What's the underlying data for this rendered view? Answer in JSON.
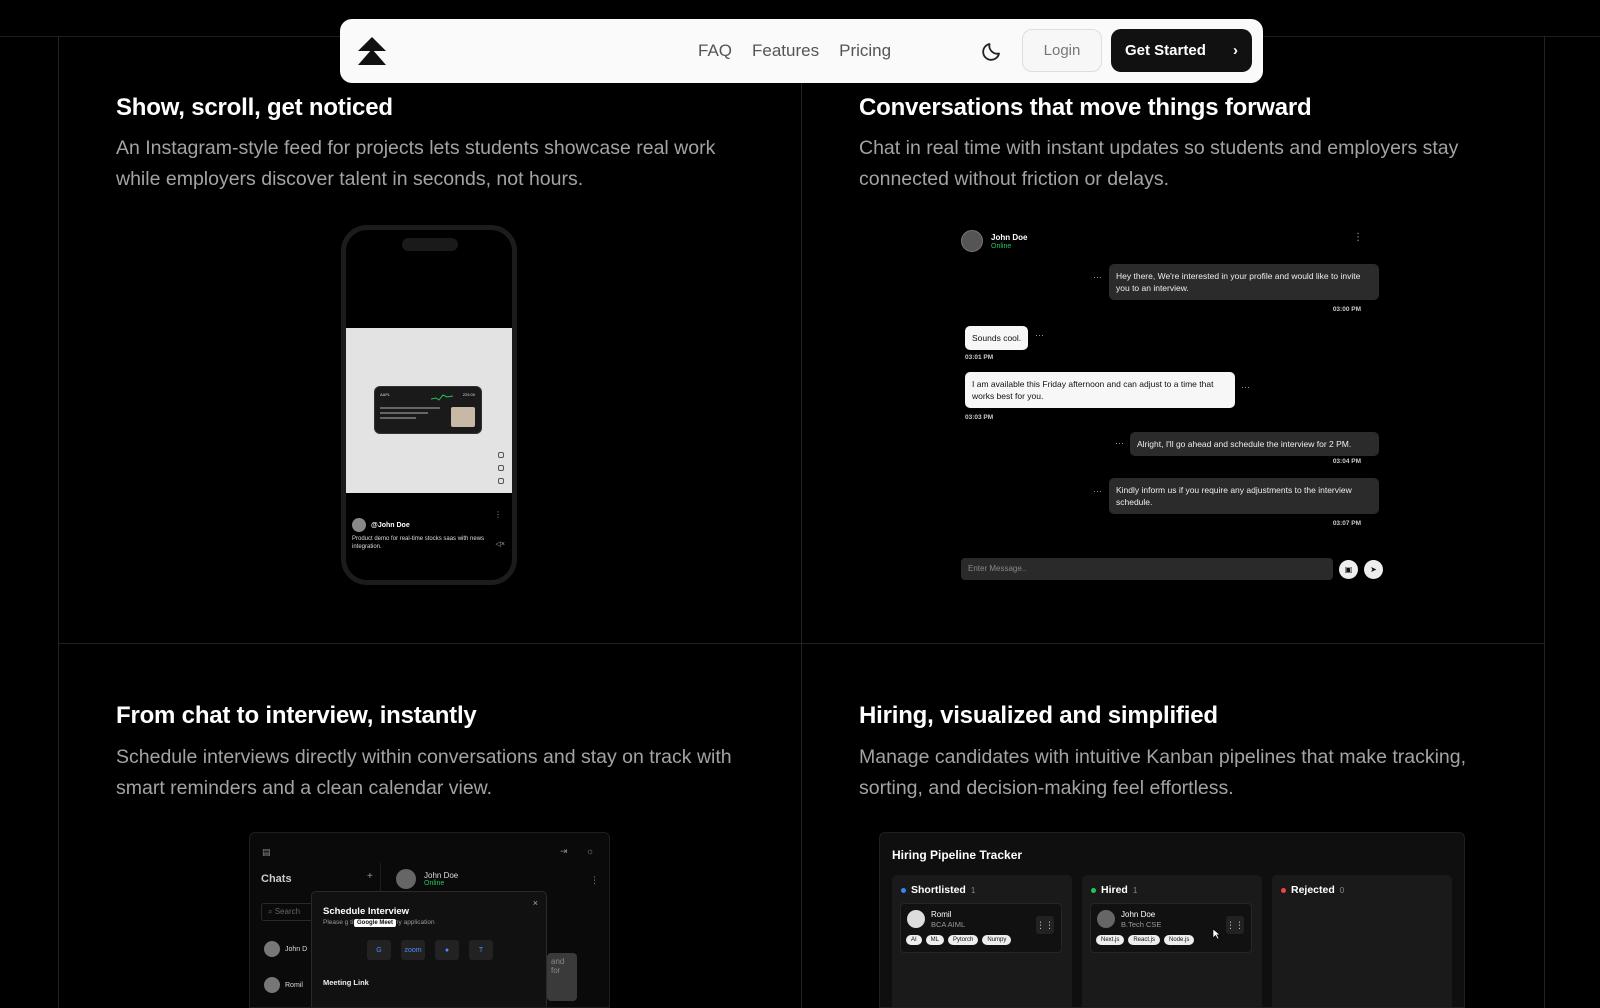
{
  "nav": {
    "links": [
      "FAQ",
      "Features",
      "Pricing"
    ],
    "login_label": "Login",
    "cta_label": "Get Started"
  },
  "sections": [
    {
      "title": "Show, scroll, get noticed",
      "description": "An Instagram-style feed for projects lets students showcase real work while employers discover talent in seconds, not hours."
    },
    {
      "title": "Conversations that move things forward",
      "description": "Chat in real time with instant updates so students and employers stay connected without friction or delays."
    },
    {
      "title": "From chat to interview, instantly",
      "description": "Schedule interviews directly within conversations and stay on track with smart reminders and a clean calendar view."
    },
    {
      "title": "Hiring, visualized and simplified",
      "description": "Manage candidates with intuitive Kanban pipelines that make tracking, sorting, and decision-making feel effortless."
    }
  ],
  "phone": {
    "username": "@John Doe",
    "caption": "Product demo for real-time stocks saas with news integration.",
    "card_ticker": "AAPL",
    "card_price": "229.00"
  },
  "chat": {
    "contact_name": "John Doe",
    "contact_status": "Online",
    "messages": [
      {
        "text": "Hey there, We're interested in your profile and would like to invite you to an interview.",
        "time": "03:00 PM"
      },
      {
        "text": "Sounds cool.",
        "time": "03:01 PM"
      },
      {
        "text": "I am available this Friday afternoon and can adjust to a time that works best for you.",
        "time": "03:03 PM"
      },
      {
        "text": "Alright, I'll go ahead and schedule the interview for 2 PM.",
        "time": "03:04 PM"
      },
      {
        "text": "Kindly inform us if you require any adjustments to the interview schedule.",
        "time": "03:07 PM"
      }
    ],
    "input_placeholder": "Enter Message.."
  },
  "schedule": {
    "chats_label": "Chats",
    "search_placeholder": "Search",
    "contact_name": "John Doe",
    "contact_status": "Online",
    "list": [
      "John D",
      "Romil"
    ],
    "modal_title": "Schedule Interview",
    "modal_subtitle": "Please g          ting link using any application",
    "tooltip": "Google Meet",
    "apps": [
      "G",
      "zoom",
      "●",
      "T"
    ],
    "meeting_link_label": "Meeting Link",
    "ghost_text": "and for"
  },
  "kanban": {
    "title": "Hiring Pipeline Tracker",
    "columns": [
      {
        "name": "Shortlisted",
        "count": "1",
        "color": "#3b82f6",
        "card": {
          "name": "Romil",
          "degree": "BCA AIML",
          "tags": [
            "AI",
            "ML",
            "Pytorch",
            "Numpy"
          ]
        }
      },
      {
        "name": "Hired",
        "count": "1",
        "color": "#22c55e",
        "card": {
          "name": "John Doe",
          "degree": "B.Tech CSE",
          "tags": [
            "Next.js",
            "React.js",
            "Node.js"
          ]
        }
      },
      {
        "name": "Rejected",
        "count": "0",
        "color": "#ef4444"
      }
    ]
  }
}
